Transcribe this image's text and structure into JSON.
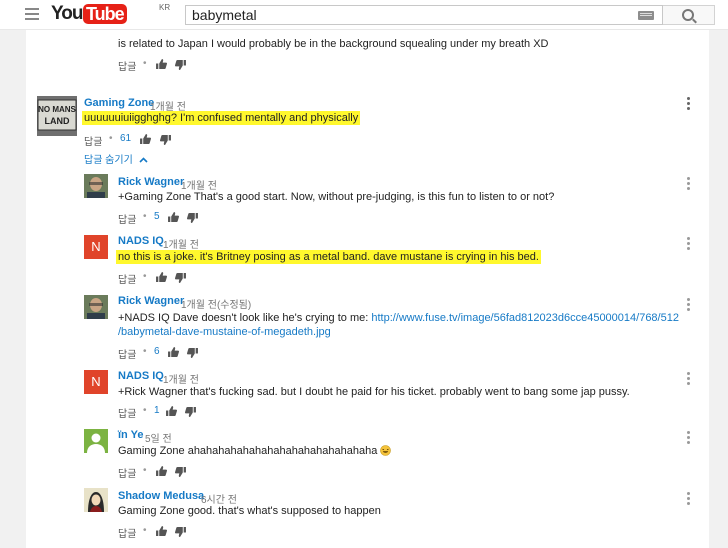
{
  "header": {
    "logo_you": "You",
    "logo_tube": "Tube",
    "region": "KR",
    "search_value": "babymetal"
  },
  "labels": {
    "reply": "답글",
    "dot": "•",
    "hide_replies": "답글 숨기기"
  },
  "previous_comment": {
    "text_tail": "is related to Japan I would probably be in the background squealing under my breath XD"
  },
  "thread": {
    "author": "Gaming Zone",
    "time": "1개월 전",
    "text": "uuuuuuiuiigghghg? I'm confused mentally and physically",
    "likes": "61",
    "avatar_lettering": "NO MANS LAND"
  },
  "replies": [
    {
      "author": "Rick Wagner",
      "time": "1개월 전",
      "text": "+Gaming Zone   That's a good start. Now, without pre-judging, is this fun to listen to or not?",
      "likes": "5"
    },
    {
      "author": "NADS IQ",
      "time": "1개월 전",
      "text": "no this is a joke. it's Britney posing as a metal band. dave mustane is crying in his bed.",
      "likes": "",
      "avatar_letter": "N"
    },
    {
      "author": "Rick Wagner",
      "time": "1개월 전(수정됨)",
      "text_prefix": "+NADS IQ Dave doesn't look like he's crying to me: ",
      "link_line1": "http://www.fuse.tv/image/56fad812023d6cce45000014/768/512",
      "link_line2": "/babymetal-dave-mustaine-of-megadeth.jpg",
      "likes": "6"
    },
    {
      "author": "NADS IQ",
      "time": "1개월 전",
      "text": "+Rick Wagner that's fucking sad. but I doubt he paid for his ticket. probably went to bang some jap pussy.",
      "likes": "1",
      "avatar_letter": "N"
    },
    {
      "author": "ïn Ye",
      "time": "5일 전",
      "text": "Gaming Zone ahahahahahahahahahahahahahahaha",
      "likes": ""
    },
    {
      "author": "Shadow Medusa",
      "time": "6시간 전",
      "text": "Gaming Zone good. that's what's  supposed to happen",
      "likes": ""
    }
  ],
  "colors": {
    "accent_link": "#167ac6",
    "highlight": "#fff82d",
    "logo_red": "#e62117",
    "nads_avatar": "#e0442a",
    "in_ye_avatar": "#7cb342"
  }
}
